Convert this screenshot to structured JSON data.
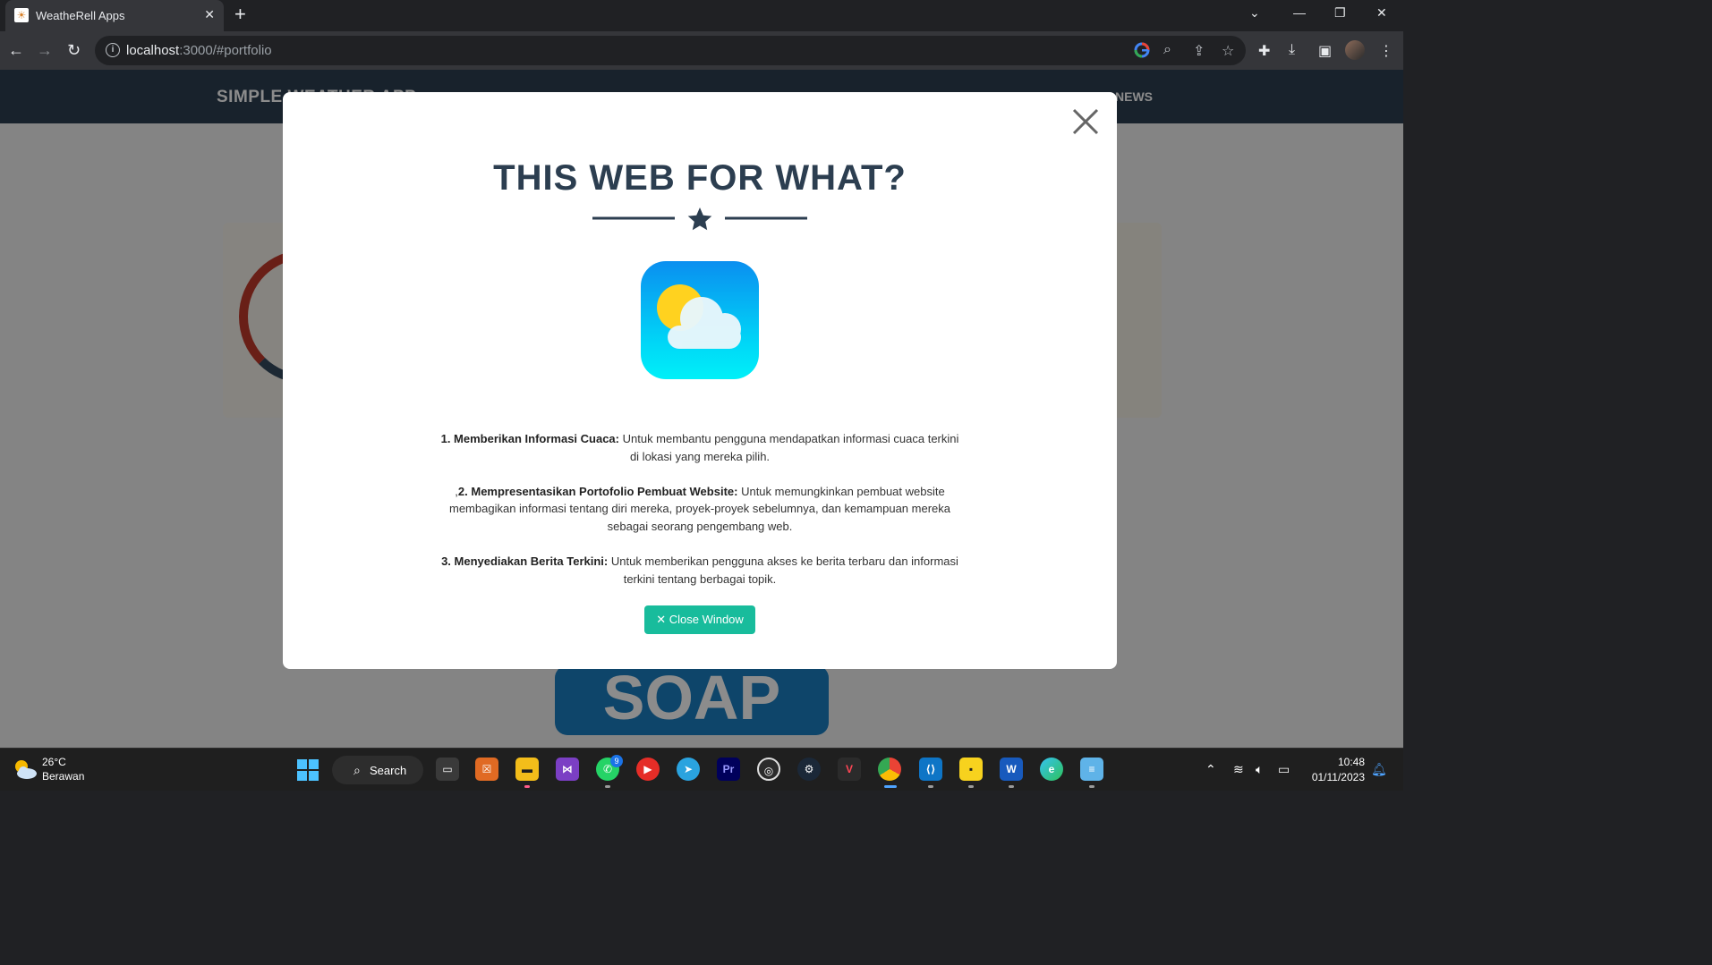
{
  "browser": {
    "tab_title": "WeatheRell Apps",
    "url_host": "localhost",
    "url_rest": ":3000/#portfolio"
  },
  "site": {
    "brand": "SIMPLE WEATHER APP",
    "nav_visible_right": "NEWS",
    "soap_text": "SOAP"
  },
  "modal": {
    "title": "THIS WEB FOR WHAT?",
    "items": [
      {
        "prefix": "",
        "heading": "1. Memberikan Informasi Cuaca:",
        "text": " Untuk membantu pengguna mendapatkan informasi cuaca terkini di lokasi yang mereka pilih."
      },
      {
        "prefix": ",",
        "heading": "2. Mempresentasikan Portofolio Pembuat Website:",
        "text": " Untuk memungkinkan pembuat website membagikan informasi tentang diri mereka, proyek-proyek sebelumnya, dan kemampuan mereka sebagai seorang pengembang web."
      },
      {
        "prefix": "",
        "heading": "3. Menyediakan Berita Terkini:",
        "text": " Untuk memberikan pengguna akses ke berita terbaru dan informasi terkini tentang berbagai topik."
      }
    ],
    "close_button": "Close Window",
    "close_glyph": "✕"
  },
  "taskbar": {
    "weather_temp": "26°C",
    "weather_desc": "Berawan",
    "search_label": "Search",
    "whatsapp_badge": "9",
    "time": "10:48",
    "date": "01/11/2023"
  },
  "colors": {
    "navy": "#2c3e50",
    "accent": "#18bc9c",
    "soap_blue": "#1a7fc1"
  }
}
